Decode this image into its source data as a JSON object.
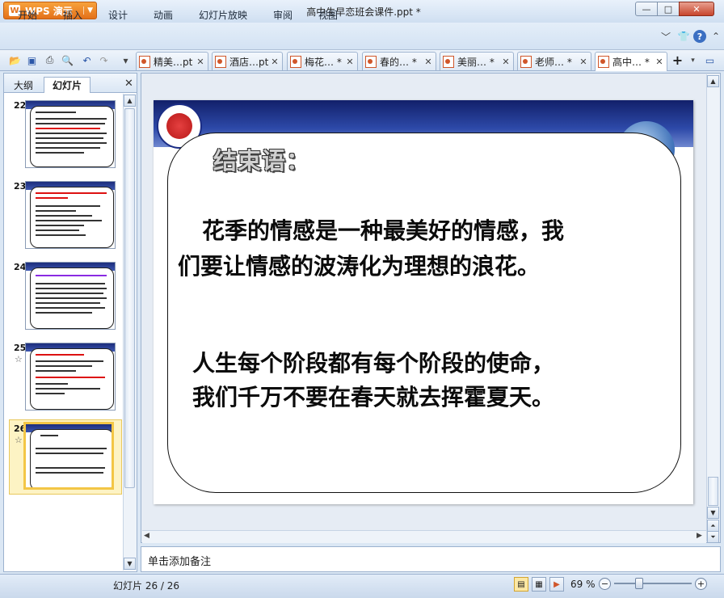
{
  "window": {
    "app_name": "WPS 演示",
    "title": "高中生早恋班会课件.ppt *",
    "min_label": "—",
    "max_label": "□",
    "close_label": "✕"
  },
  "menu": [
    "开始",
    "插入",
    "设计",
    "动画",
    "幻灯片放映",
    "审阅",
    "视图"
  ],
  "doc_tabs": [
    {
      "label": "精美…pt"
    },
    {
      "label": "酒店…pt"
    },
    {
      "label": "梅花… *"
    },
    {
      "label": "春的… *"
    },
    {
      "label": "美丽… *"
    },
    {
      "label": "老师… *"
    },
    {
      "label": "高中… *"
    }
  ],
  "panel": {
    "tab_outline": "大纲",
    "tab_slides": "幻灯片",
    "close": "✕"
  },
  "thumbnails": [
    {
      "num": "22",
      "star": ""
    },
    {
      "num": "23",
      "star": ""
    },
    {
      "num": "24",
      "star": ""
    },
    {
      "num": "25",
      "star": "☆"
    },
    {
      "num": "26",
      "star": "☆"
    }
  ],
  "slide": {
    "heading": "结束语：",
    "line1": "花季的情感是一种最美好的情感，我",
    "line2": "们要让情感的波涛化为理想的浪花。",
    "line3": "人生每个阶段都有每个阶段的使命，",
    "line4": "我们千万不要在春天就去挥霍夏天。"
  },
  "notes_placeholder": "单击添加备注",
  "status": {
    "slide_counter": "幻灯片 26 / 26",
    "zoom": "69 %",
    "zoom_minus": "−",
    "zoom_plus": "+"
  },
  "colors": {
    "accent_orange": "#e4711a",
    "slide_header_blue": "#1b2d85",
    "selected_thumb": "#f3c646"
  }
}
